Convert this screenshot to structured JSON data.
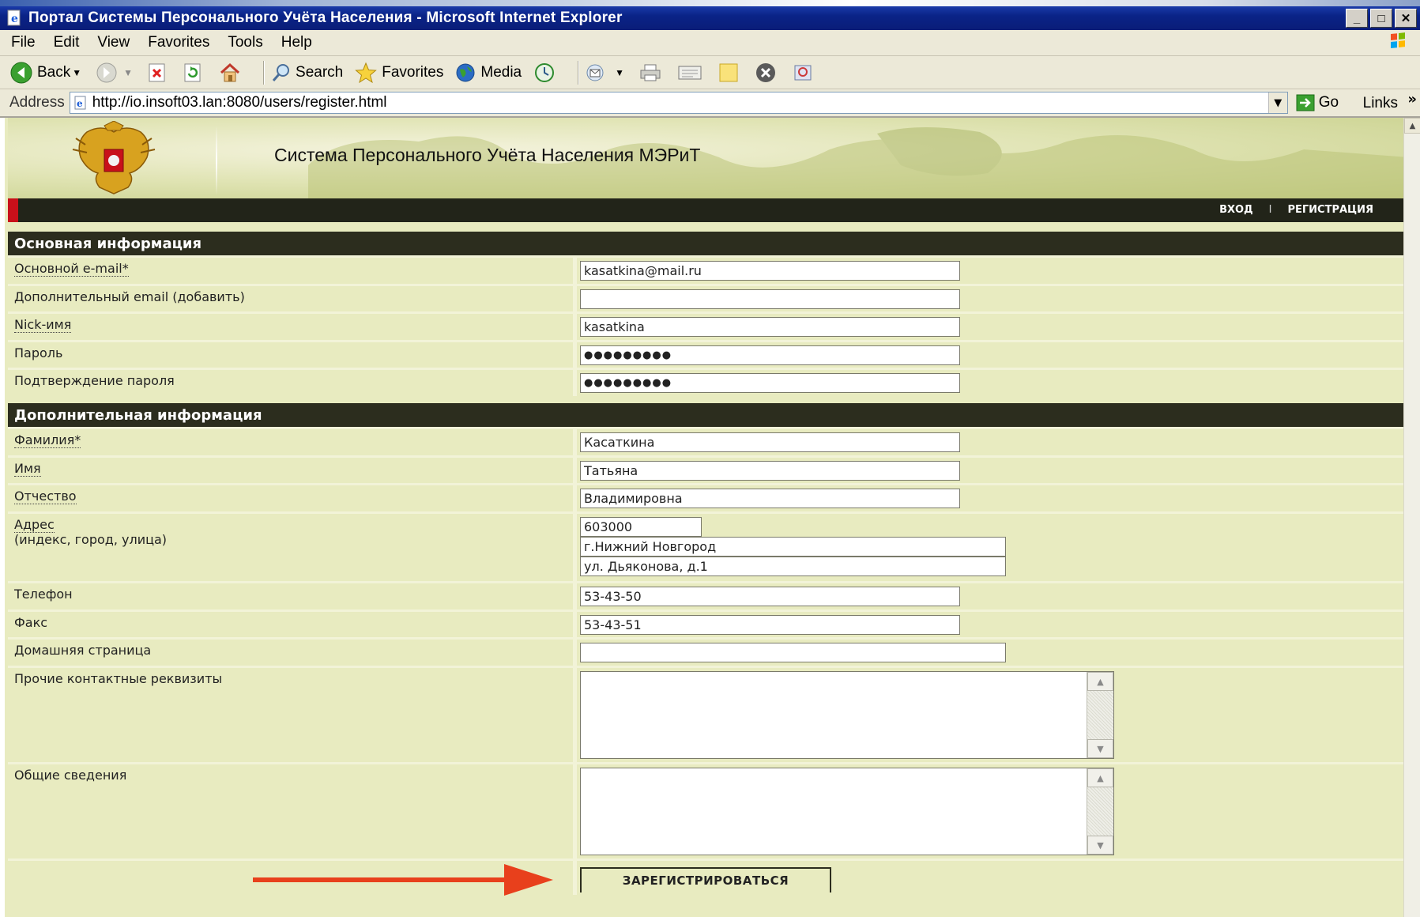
{
  "window": {
    "title": "Портал Системы Персонального Учёта Населения - Microsoft Internet Explorer",
    "buttons": [
      "_",
      "□",
      "✕"
    ]
  },
  "menu": [
    "File",
    "Edit",
    "View",
    "Favorites",
    "Tools",
    "Help"
  ],
  "toolbar": {
    "back_label": "Back",
    "search_label": "Search",
    "favorites_label": "Favorites",
    "media_label": "Media"
  },
  "address": {
    "label": "Address",
    "url": "http://io.insoft03.lan:8080/users/register.html",
    "go_label": "Go",
    "links_label": "Links",
    "links_chevron": "»"
  },
  "site": {
    "title": "Система Персонального Учёта Населения МЭРиТ",
    "nav": [
      "ВХОД",
      "I",
      "РЕГИСТРАЦИЯ"
    ]
  },
  "form": {
    "section1_title": "Основная информация",
    "section2_title": "Дополнительная информация",
    "email_label": "Основной e-mail*",
    "email_value": "kasatkina@mail.ru",
    "email2_label": "Дополнительный email (добавить)",
    "email2_value": "",
    "nick_label": "Nick-имя",
    "nick_value": "kasatkina",
    "password_label": "Пароль",
    "password_value": "●●●●●●●●●",
    "password2_label": "Подтверждение пароля",
    "password2_value": "●●●●●●●●●",
    "surname_label": "Фамилия*",
    "surname_value": "Касаткина",
    "name_label": "Имя",
    "name_value": "Татьяна",
    "patronymic_label": "Отчество",
    "patronymic_value": "Владимировна",
    "address_label": "Адрес",
    "address_hint": "(индекс, город, улица)",
    "address_index": "603000",
    "address_city": "г.Нижний Новгород",
    "address_street": "ул. Дьяконова, д.1",
    "phone_label": "Телефон",
    "phone_value": "53-43-50",
    "fax_label": "Факс",
    "fax_value": "53-43-51",
    "homepage_label": "Домашняя страница",
    "homepage_value": "",
    "other_contacts_label": "Прочие контактные реквизиты",
    "general_info_label": "Общие сведения",
    "submit_label": "ЗАРЕГИСТРИРОВАТЬСЯ"
  },
  "colors": {
    "titlebar": "#0a2387",
    "page_bg": "#e8ebc0",
    "section_head": "#2c2d1e",
    "arrow": "#e8401c",
    "nav_red": "#c8101a"
  }
}
